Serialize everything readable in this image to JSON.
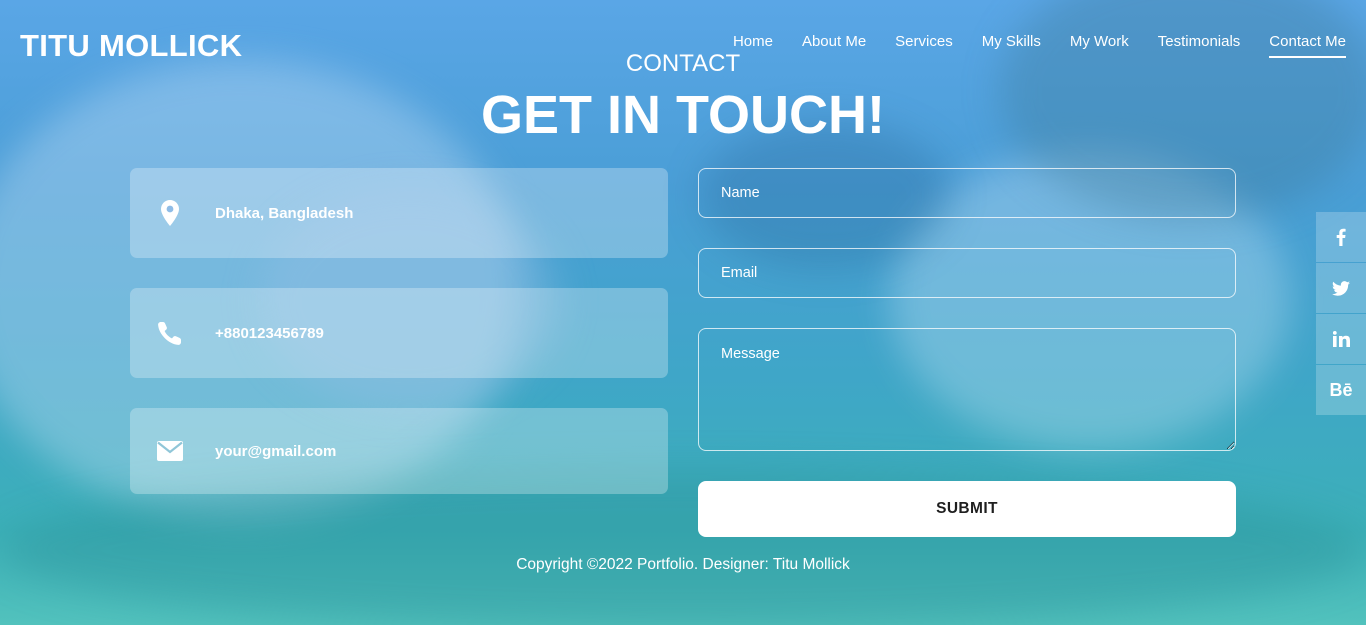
{
  "header": {
    "brand": "TITU MOLLICK",
    "nav": [
      "Home",
      "About Me",
      "Services",
      "My Skills",
      "My Work",
      "Testimonials",
      "Contact Me"
    ],
    "active_nav": "Contact Me"
  },
  "section": {
    "subtitle": "CONTACT",
    "title": "GET IN TOUCH!"
  },
  "contact_info": {
    "location": {
      "icon": "map-pin-icon",
      "text": "Dhaka, Bangladesh"
    },
    "phone": {
      "icon": "phone-icon",
      "text": "+880123456789"
    },
    "email": {
      "icon": "envelope-icon",
      "text": "your@gmail.com"
    }
  },
  "form": {
    "name_placeholder": "Name",
    "email_placeholder": "Email",
    "message_placeholder": "Message",
    "submit_label": "SUBMIT"
  },
  "footer": {
    "copyright": "Copyright ©2022 Portfolio. Designer: Titu Mollick"
  },
  "social": [
    {
      "icon": "facebook-icon",
      "glyph": "f"
    },
    {
      "icon": "twitter-icon",
      "glyph": ""
    },
    {
      "icon": "linkedin-icon",
      "glyph": "in"
    },
    {
      "icon": "behance-icon",
      "glyph": "Bē"
    }
  ],
  "colors": {
    "overlay_top": "#5aa6e6",
    "overlay_bottom": "#52c2bd",
    "submit_bg": "#ffffff",
    "submit_text": "#1f1f1f"
  }
}
